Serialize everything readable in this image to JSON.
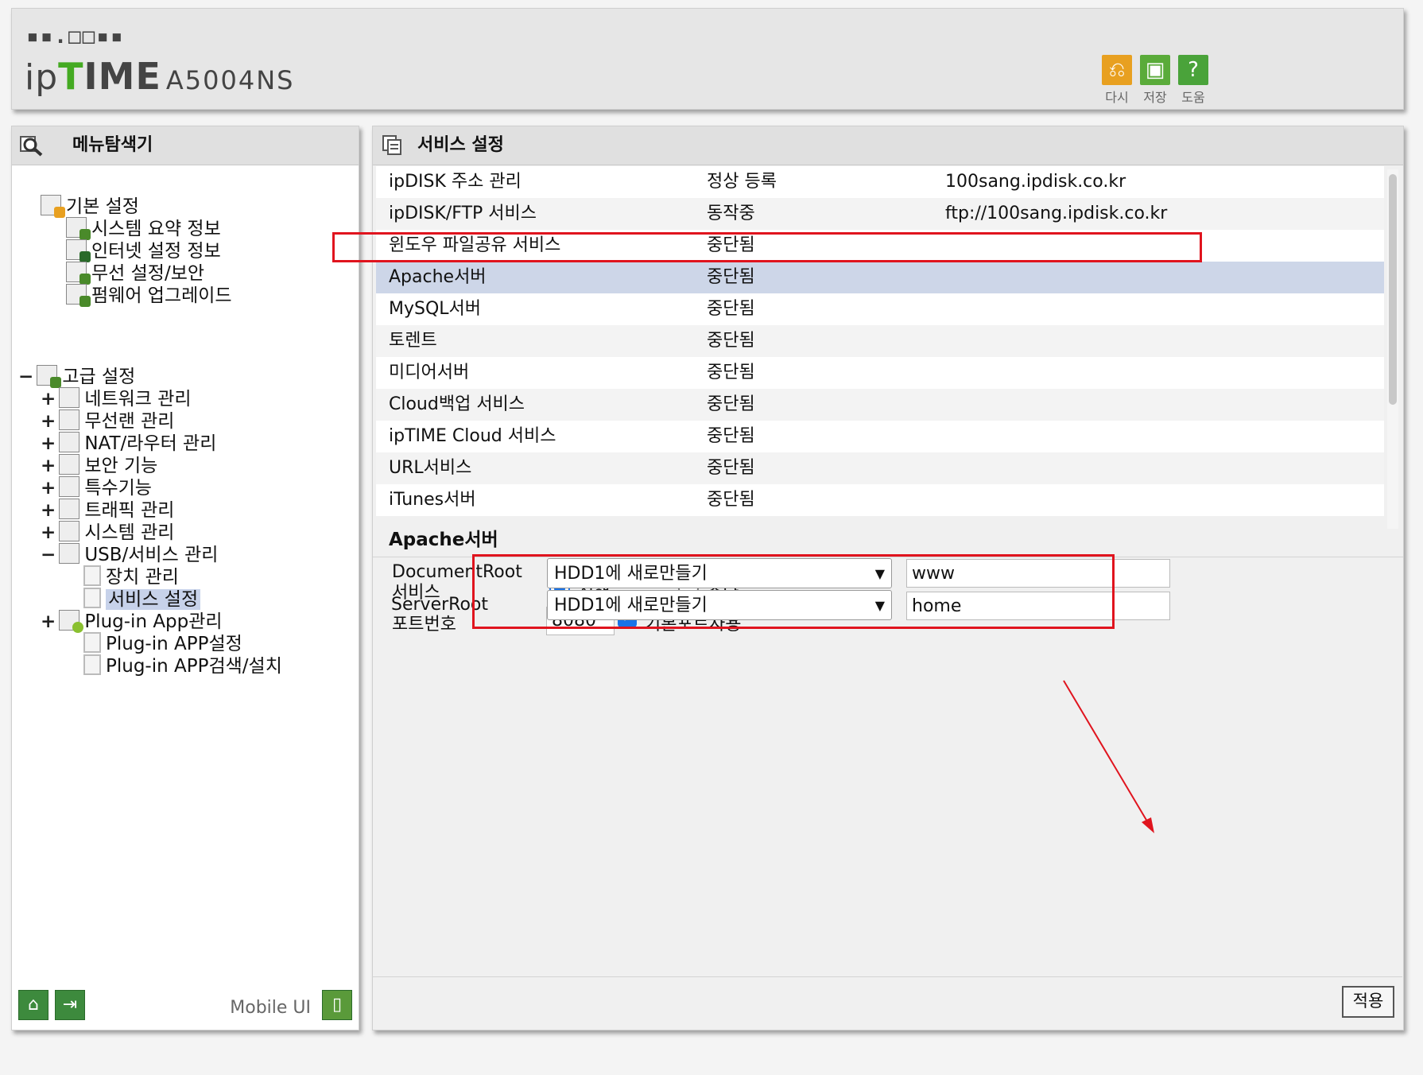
{
  "header": {
    "logo_dots": "▪▪.□□▪▪",
    "brand_ip": "ip",
    "brand_time": "TIME",
    "model": "A5004NS",
    "buttons": [
      {
        "label": "다시",
        "icon": "undo-icon",
        "color": "#e8a020"
      },
      {
        "label": "저장",
        "icon": "save-icon",
        "color": "#5aab3a"
      },
      {
        "label": "도움",
        "icon": "help-icon",
        "color": "#4aa33a"
      }
    ]
  },
  "left": {
    "title": "메뉴탐색기",
    "basic": {
      "label": "기본 설정",
      "items": [
        "시스템 요약 정보",
        "인터넷 설정 정보",
        "무선 설정/보안",
        "펌웨어 업그레이드"
      ]
    },
    "advanced": {
      "label": "고급 설정",
      "items": [
        "네트워크 관리",
        "무선랜 관리",
        "NAT/라우터 관리",
        "보안 기능",
        "특수기능",
        "트래픽 관리",
        "시스템 관리",
        "USB/서비스 관리"
      ],
      "usb_children": [
        "장치 관리",
        "서비스 설정"
      ],
      "plugin": "Plug-in App관리",
      "plugin_children": [
        "Plug-in APP설정",
        "Plug-in APP검색/설치"
      ]
    },
    "footer": {
      "mobile_label": "Mobile UI"
    }
  },
  "right": {
    "title": "서비스 설정",
    "services": [
      {
        "name": "ipDISK 주소 관리",
        "status": "정상 등록",
        "info": "100sang.ipdisk.co.kr"
      },
      {
        "name": "ipDISK/FTP 서비스",
        "status": "동작중",
        "info": "ftp://100sang.ipdisk.co.kr"
      },
      {
        "name": "윈도우 파일공유 서비스",
        "status": "중단됨",
        "info": ""
      },
      {
        "name": "Apache서버",
        "status": "중단됨",
        "info": ""
      },
      {
        "name": "MySQL서버",
        "status": "중단됨",
        "info": ""
      },
      {
        "name": "토렌트",
        "status": "중단됨",
        "info": ""
      },
      {
        "name": "미디어서버",
        "status": "중단됨",
        "info": ""
      },
      {
        "name": "Cloud백업 서비스",
        "status": "중단됨",
        "info": ""
      },
      {
        "name": "ipTIME Cloud 서비스",
        "status": "중단됨",
        "info": ""
      },
      {
        "name": "URL서비스",
        "status": "중단됨",
        "info": ""
      },
      {
        "name": "iTunes서버",
        "status": "중단됨",
        "info": ""
      }
    ],
    "section": {
      "title": "Apache서버",
      "service_label": "서비스",
      "opt_run": "실행",
      "opt_stop": "중단",
      "port_label": "포트번호",
      "port_value": "8080",
      "default_port_label": "기본포트사용",
      "docroot_label": "DocumentRoot",
      "docroot_select": "HDD1에 새로만들기",
      "docroot_value": "www",
      "serverroot_label": "ServerRoot",
      "serverroot_select": "HDD1에 새로만들기",
      "serverroot_value": "home"
    },
    "apply": "적용"
  },
  "annotation_color": "#e0141e"
}
